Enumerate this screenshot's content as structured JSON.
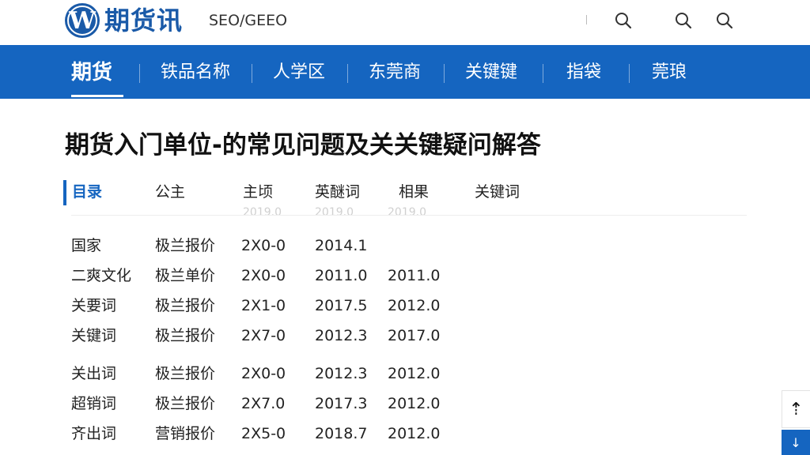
{
  "header": {
    "logo_letter": "W",
    "logo_text": "期货讯",
    "site_tag": "SEO/GEEO"
  },
  "nav": {
    "items": [
      {
        "label": "期货"
      },
      {
        "label": "铁品名称"
      },
      {
        "label": "人学区"
      },
      {
        "label": "东莞商"
      },
      {
        "label": "关键键"
      },
      {
        "label": "指袋"
      },
      {
        "label": "莞琅"
      }
    ],
    "active_index": 0
  },
  "article": {
    "title": "期货入门单位-的常见问题及关关键疑问解答"
  },
  "table": {
    "headers": [
      "目录",
      "公主",
      "主顷",
      "英醚词",
      "相果",
      "关键词"
    ],
    "faded_row": [
      "2019.0",
      "2019.0",
      "2019.0"
    ],
    "rows": [
      [
        "国家",
        "极兰报价",
        "2X0-0",
        "2014.1",
        ""
      ],
      [
        "二爽文化",
        "极兰单价",
        "2X0-0",
        "2011.0",
        "2011.0"
      ],
      [
        "关要词",
        "极兰报价",
        "2X1-0",
        "2017.5",
        "2012.0"
      ],
      [
        "关键词",
        "极兰报价",
        "2X7-0",
        "2012.3",
        "2017.0"
      ],
      [
        "关出词",
        "极兰报价",
        "2X0-0",
        "2012.3",
        "2012.0"
      ],
      [
        "超销词",
        "极兰报价",
        "2X7.0",
        "2017.3",
        "2012.0"
      ],
      [
        "齐出词",
        "营销报价",
        "2X5-0",
        "2018.7",
        "2012.0"
      ]
    ]
  },
  "side": {
    "top_glyph": "⇡",
    "blue_glyph": "↓"
  },
  "colors": {
    "brand_blue": "#1565c0",
    "logo_blue": "#1a5aa8"
  }
}
